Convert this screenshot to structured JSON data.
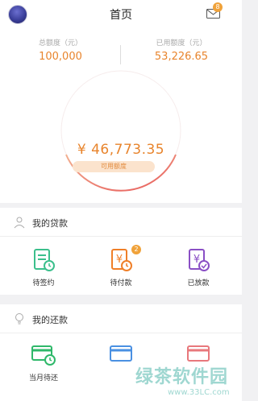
{
  "header": {
    "title": "首页",
    "mail_badge": "8"
  },
  "summary": {
    "total_label": "总额度（元）",
    "total_value": "100,000",
    "used_label": "已用额度（元）",
    "used_value": "53,226.65",
    "available_value": "¥ 46,773.35",
    "available_label": "可用额度"
  },
  "loans": {
    "title": "我的贷款",
    "items": [
      {
        "label": "待签约",
        "color": "#3bbf8c",
        "icon": "contract-doc-icon"
      },
      {
        "label": "待付款",
        "color": "#ef7f28",
        "icon": "yuan-clock-icon",
        "badge": "2"
      },
      {
        "label": "已放款",
        "color": "#8a4fc5",
        "icon": "yuan-check-icon"
      }
    ]
  },
  "repay": {
    "title": "我的还款",
    "items": [
      {
        "label": "当月待还",
        "color": "#2fb86a",
        "icon": "card-clock-icon"
      },
      {
        "label": "",
        "color": "#4a90e2",
        "icon": "card-icon"
      },
      {
        "label": "",
        "color": "#e8787c",
        "icon": "card-icon"
      }
    ]
  },
  "watermark": {
    "text": "绿茶软件园",
    "url": "www.33LC.com"
  },
  "colors": {
    "accent": "#e8842c",
    "gauge_start": "#e8842c",
    "gauge_end": "#e85a5a"
  }
}
